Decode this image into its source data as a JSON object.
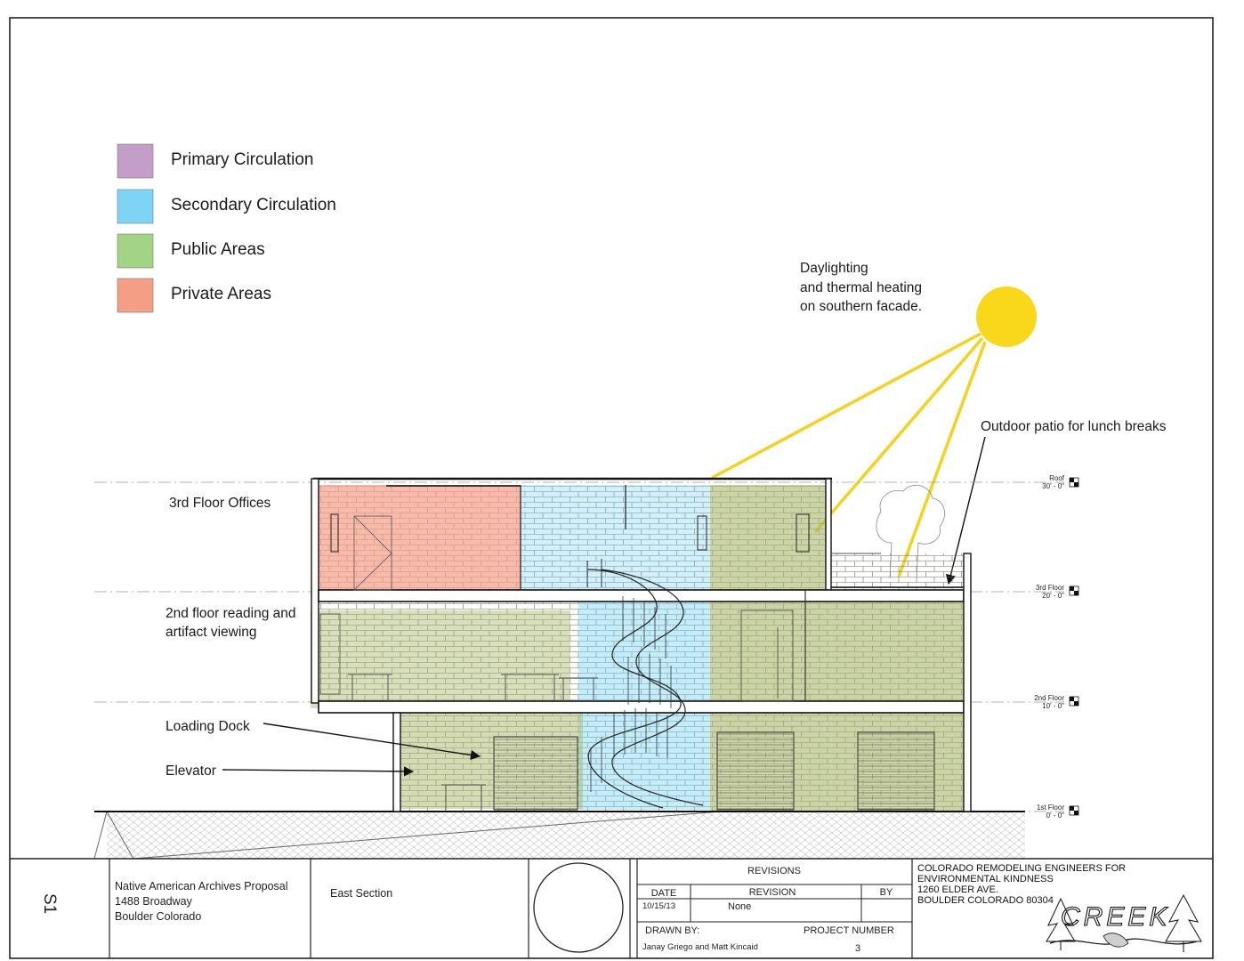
{
  "legend": [
    {
      "label": "Primary Circulation",
      "color": "#c39ec9"
    },
    {
      "label": "Secondary Circulation",
      "color": "#7dd4f5"
    },
    {
      "label": "Public Areas",
      "color": "#a3d385"
    },
    {
      "label": "Private Areas",
      "color": "#f49f85"
    }
  ],
  "annotations": {
    "daylight": [
      "Daylighting",
      "and thermal heating",
      "on southern facade."
    ],
    "patio": "Outdoor patio for lunch breaks",
    "third_floor": "3rd Floor Offices",
    "second_floor": [
      "2nd floor reading and",
      "artifact viewing"
    ],
    "loading_dock": "Loading Dock",
    "elevator": "Elevator"
  },
  "levels": [
    {
      "name": "Roof",
      "elev": "30' - 0\""
    },
    {
      "name": "3rd Floor",
      "elev": "20' - 0\""
    },
    {
      "name": "2nd Floor",
      "elev": "10' - 0\""
    },
    {
      "name": "1st Floor",
      "elev": "0' - 0\""
    }
  ],
  "title_block": {
    "sheet_number": "S1",
    "project": [
      "Native American Archives Proposal",
      "1488 Broadway",
      "Boulder Colorado"
    ],
    "drawing_title": "East Section",
    "revisions_header": "REVISIONS",
    "date_label": "DATE",
    "revision_label": "REVISION",
    "by_label": "BY",
    "date_value": "10/15/13",
    "revision_value": "None",
    "drawn_by_label": "DRAWN BY:",
    "drawn_by_value": "Janay Griego and Matt Kincaid",
    "project_number_label": "PROJECT NUMBER",
    "project_number_value": "3",
    "firm": [
      "COLORADO REMODELING ENGINEERS FOR",
      "ENVIRONMENTAL KINDNESS",
      "1260 ELDER AVE.",
      "BOULDER  COLORADO 80304"
    ],
    "logo_text": "CREEK"
  },
  "colors": {
    "sun": "#f9d81c",
    "sun_ray": "#f4d21e",
    "private_fill": "#f4a08a",
    "secondary_fill": "#7dd4f5",
    "public_fill": "#a9b86a"
  }
}
